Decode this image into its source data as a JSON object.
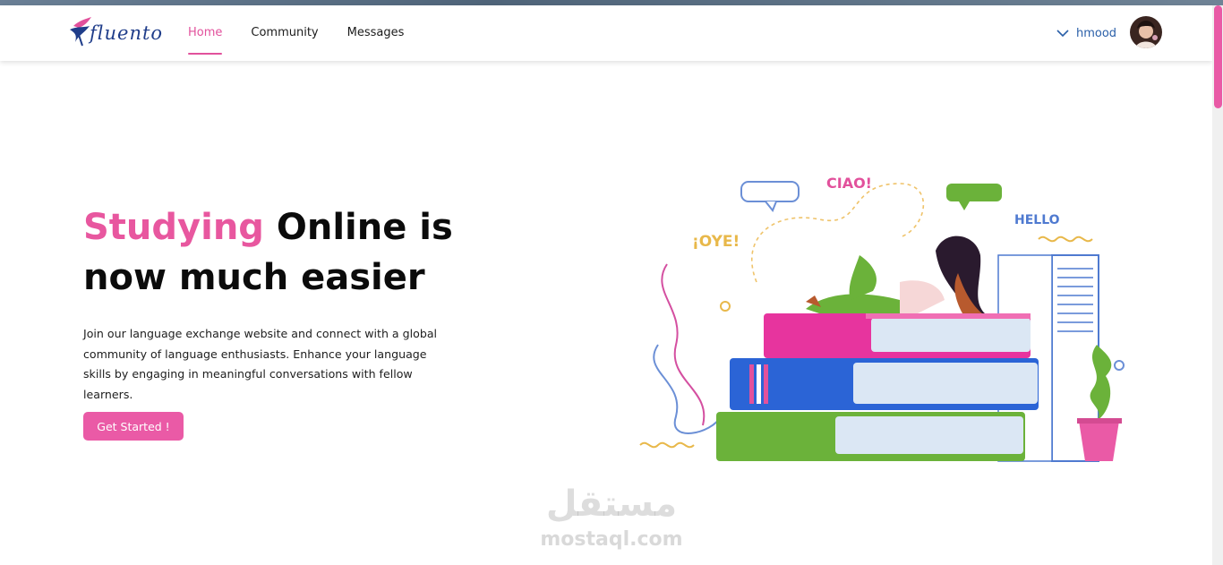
{
  "brand": {
    "logo_text": "fluento"
  },
  "nav": {
    "items": [
      {
        "label": "Home",
        "active": true
      },
      {
        "label": "Community",
        "active": false
      },
      {
        "label": "Messages",
        "active": false
      }
    ]
  },
  "user": {
    "name": "hmood"
  },
  "hero": {
    "title_highlight": "Studying",
    "title_rest_1": " Online is",
    "title_line_2": "now much easier",
    "description": "Join our language exchange website and connect with a global community of language enthusiasts. Enhance your language skills by engaging in meaningful conversations with fellow learners.",
    "cta_label": "Get Started !"
  },
  "illustration": {
    "bubble_1": "CIAO!",
    "bubble_2": "¡OYE!",
    "bubble_3": "HELLO"
  },
  "watermark": {
    "arabic": "مستقل",
    "latin": "mostaql.com"
  },
  "colors": {
    "accent": "#e8579f",
    "brand_blue": "#1f3d8a",
    "user_blue": "#2a5fa8"
  }
}
